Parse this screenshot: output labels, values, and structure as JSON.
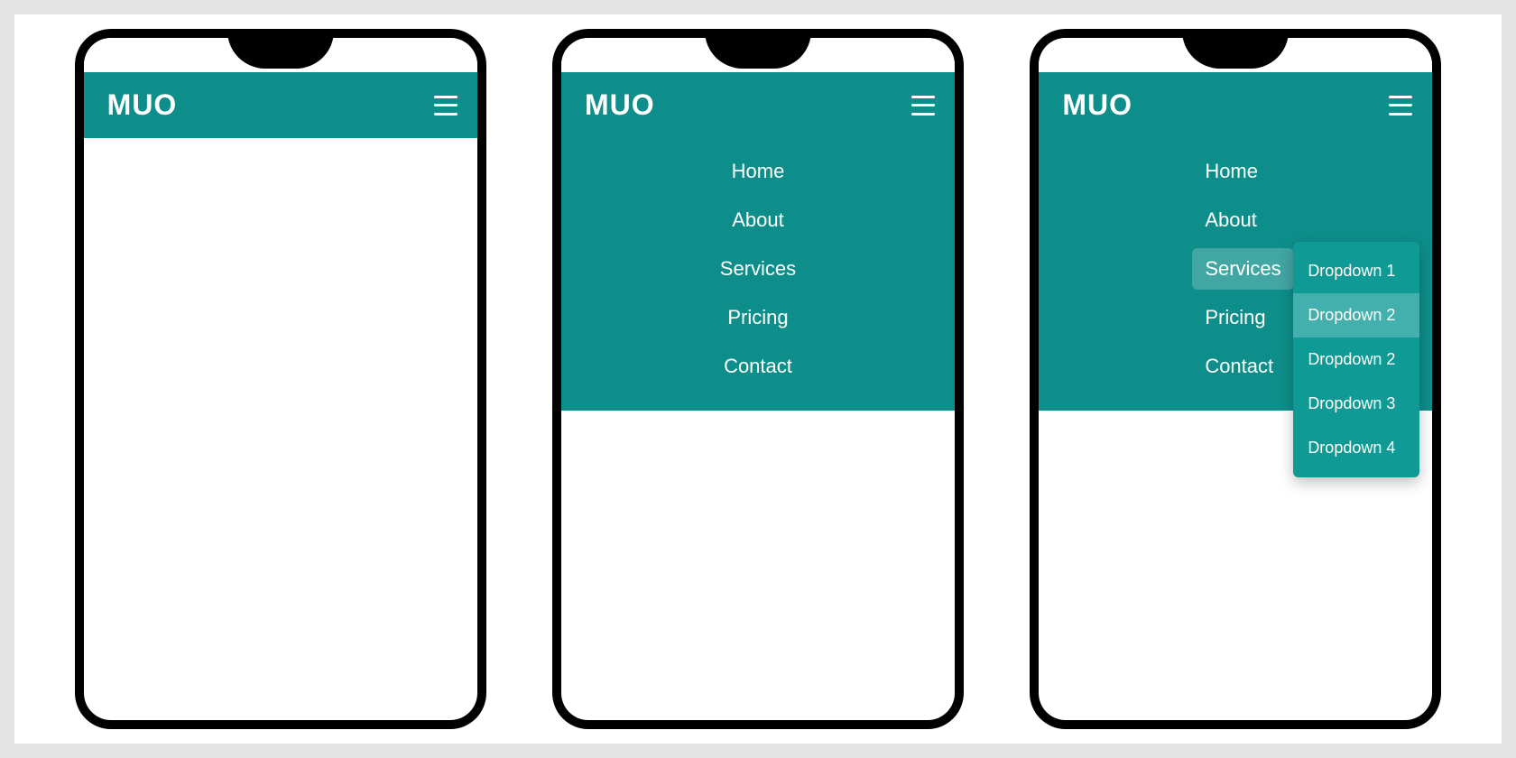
{
  "brand": "MUO",
  "accent_color": "#0e8e8a",
  "menu": {
    "items": [
      {
        "label": "Home"
      },
      {
        "label": "About"
      },
      {
        "label": "Services"
      },
      {
        "label": "Pricing"
      },
      {
        "label": "Contact"
      }
    ]
  },
  "dropdown": {
    "parent": "Services",
    "items": [
      {
        "label": "Dropdown 1"
      },
      {
        "label": "Dropdown 2"
      },
      {
        "label": "Dropdown 2"
      },
      {
        "label": "Dropdown 3"
      },
      {
        "label": "Dropdown 4"
      }
    ],
    "highlighted_index": 1
  },
  "phones": [
    {
      "state": "closed"
    },
    {
      "state": "menu-open"
    },
    {
      "state": "submenu-open"
    }
  ]
}
